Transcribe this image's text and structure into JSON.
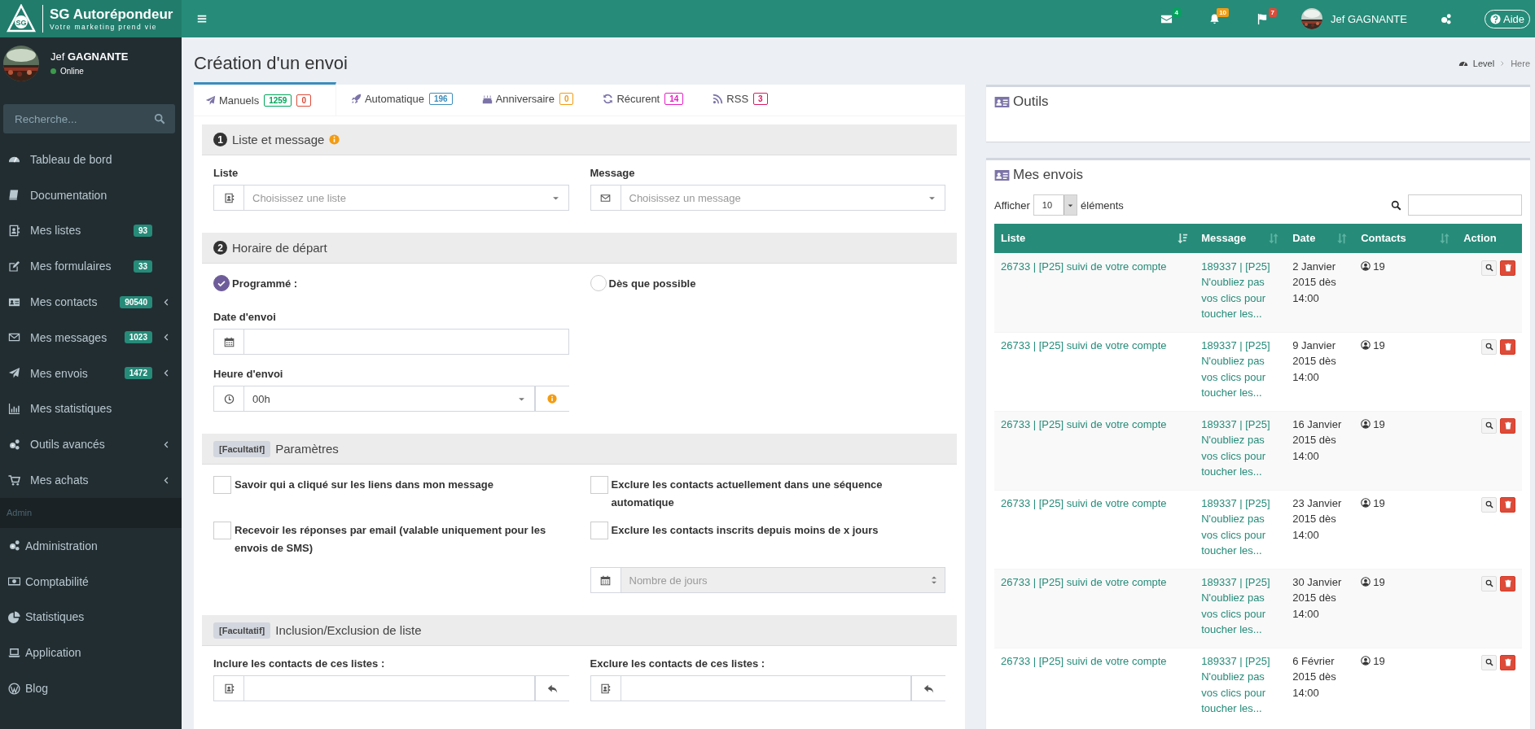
{
  "brand": {
    "logo_text": "SG",
    "name": "SG Autorépondeur",
    "tagline": "Votre marketing prend vie"
  },
  "header": {
    "notifications": [
      {
        "kind": "mail",
        "count": "4",
        "color": "#00a65a"
      },
      {
        "kind": "bell",
        "count": "10",
        "color": "#f39c12"
      },
      {
        "kind": "flag",
        "count": "7",
        "color": "#dd4b39"
      }
    ],
    "user": "Jef GAGNANTE",
    "help": "Aide"
  },
  "sidebar": {
    "user": {
      "first_name": "Jef",
      "last_name": "GAGNANTE",
      "status": "Online"
    },
    "search": {
      "placeholder": "Recherche..."
    },
    "items": [
      {
        "label": "Tableau de bord",
        "submenu": false
      },
      {
        "label": "Documentation",
        "submenu": false
      },
      {
        "label": "Mes listes",
        "badge": "93",
        "submenu": false
      },
      {
        "label": "Mes formulaires",
        "badge": "33",
        "submenu": false
      },
      {
        "label": "Mes contacts",
        "badge": "90540",
        "submenu": true
      },
      {
        "label": "Mes messages",
        "badge": "1023",
        "submenu": true
      },
      {
        "label": "Mes envois",
        "badge": "1472",
        "submenu": true
      },
      {
        "label": "Mes statistiques",
        "submenu": false
      },
      {
        "label": "Outils avancés",
        "submenu": true
      },
      {
        "label": "Mes achats",
        "submenu": true
      }
    ],
    "section": "Admin",
    "admin_items": [
      {
        "label": "Administration"
      },
      {
        "label": "Comptabilité"
      },
      {
        "label": "Statistiques"
      },
      {
        "label": "Application"
      },
      {
        "label": "Blog"
      }
    ]
  },
  "page_title": "Création d'un envoi",
  "breadcrumb": [
    "Level",
    "Here"
  ],
  "tabs": [
    {
      "label": "Manuels",
      "selected": true,
      "badges": [
        {
          "text": "1259",
          "color": "#00a65a"
        },
        {
          "text": "0",
          "color": "#dd4b39"
        }
      ]
    },
    {
      "label": "Automatique",
      "selected": false,
      "badges": [
        {
          "text": "196",
          "color": "#3c8dbc"
        }
      ]
    },
    {
      "label": "Anniversaire",
      "selected": false,
      "badges": [
        {
          "text": "0",
          "color": "#f39c12"
        }
      ]
    },
    {
      "label": "Récurent",
      "selected": false,
      "badges": [
        {
          "text": "14",
          "color": "#e61ec4"
        }
      ]
    },
    {
      "label": "RSS",
      "selected": false,
      "badges": [
        {
          "text": "3",
          "color": "#d81b60"
        }
      ]
    }
  ],
  "list_section": {
    "number": "1",
    "title": "Liste et message",
    "fields": [
      {
        "label": "Liste",
        "placeholder": "Choisissez une liste"
      },
      {
        "label": "Message",
        "placeholder": "Choisissez un message"
      }
    ]
  },
  "schedule_section": {
    "number": "2",
    "title": "Horaire de départ",
    "options": [
      {
        "label": "Programmé :",
        "selected": true
      },
      {
        "label": "Dès que possible",
        "selected": false
      }
    ],
    "date_label": "Date d'envoi",
    "time_label": "Heure d'envoi",
    "time_value": "00h"
  },
  "params_section": {
    "tag": "[Facultatif]",
    "title": "Paramètres",
    "checks": [
      {
        "label": "Savoir qui a cliqué sur les liens dans mon message",
        "checked": false
      },
      {
        "label": "Exclure les contacts actuellement dans une séquence automatique",
        "checked": false
      },
      {
        "label": "Recevoir les réponses par email (valable uniquement pour les envois de SMS)",
        "checked": false
      },
      {
        "label": "Exclure les contacts inscrits depuis moins de x jours",
        "checked": false
      }
    ],
    "days": {
      "placeholder": "Nombre de jours",
      "disabled": true
    }
  },
  "lists_section": {
    "tag": "[Facultatif]",
    "title": "Inclusion/Exclusion de liste",
    "fields": [
      {
        "label": "Inclure les contacts de ces listes :"
      },
      {
        "label": "Exclure les contacts de ces listes :"
      }
    ]
  },
  "tools_panel": {
    "title": "Outils"
  },
  "sends_panel": {
    "title": "Mes envois",
    "show_label": "Afficher",
    "page_size": "10",
    "elements_label": "éléments",
    "columns": [
      {
        "label": "Liste",
        "sortable": true,
        "sorted": true
      },
      {
        "label": "Message",
        "sortable": true,
        "sorted": false
      },
      {
        "label": "Date",
        "sortable": true,
        "sorted": false
      },
      {
        "label": "Contacts",
        "sortable": true,
        "sorted": false
      },
      {
        "label": "Action",
        "sortable": false
      }
    ],
    "rows": [
      {
        "list": "26733 | [P25] suivi de votre compte",
        "message": "189337 | [P25] N'oubliez pas vos clics pour toucher les...",
        "date": "2 Janvier 2015 dès 14:00",
        "contacts": "19"
      },
      {
        "list": "26733 | [P25] suivi de votre compte",
        "message": "189337 | [P25] N'oubliez pas vos clics pour toucher les...",
        "date": "9 Janvier 2015 dès 14:00",
        "contacts": "19"
      },
      {
        "list": "26733 | [P25] suivi de votre compte",
        "message": "189337 | [P25] N'oubliez pas vos clics pour toucher les...",
        "date": "16 Janvier 2015 dès 14:00",
        "contacts": "19"
      },
      {
        "list": "26733 | [P25] suivi de votre compte",
        "message": "189337 | [P25] N'oubliez pas vos clics pour toucher les...",
        "date": "23 Janvier 2015 dès 14:00",
        "contacts": "19"
      },
      {
        "list": "26733 | [P25] suivi de votre compte",
        "message": "189337 | [P25] N'oubliez pas vos clics pour toucher les...",
        "date": "30 Janvier 2015 dès 14:00",
        "contacts": "19"
      },
      {
        "list": "26733 | [P25] suivi de votre compte",
        "message": "189337 | [P25] N'oubliez pas vos clics pour toucher les...",
        "date": "6 Février 2015 dès 14:00",
        "contacts": "19"
      }
    ]
  }
}
